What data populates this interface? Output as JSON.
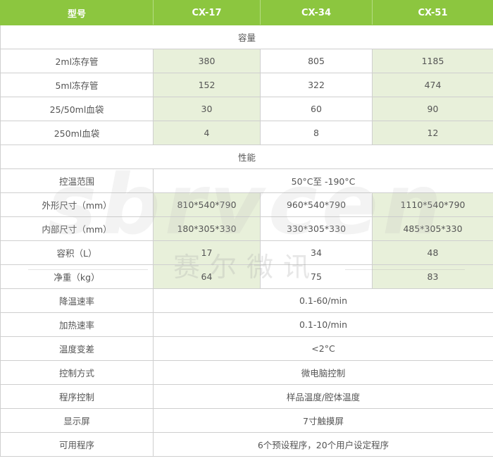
{
  "header": {
    "model_label": "型号",
    "models": [
      "CX-17",
      "CX-34",
      "CX-51"
    ]
  },
  "sections": {
    "capacity": "容量",
    "performance": "性能"
  },
  "capacity_rows": [
    {
      "label": "2ml冻存管",
      "values": [
        "380",
        "805",
        "1185"
      ]
    },
    {
      "label": "5ml冻存管",
      "values": [
        "152",
        "322",
        "474"
      ]
    },
    {
      "label": "25/50ml血袋",
      "values": [
        "30",
        "60",
        "90"
      ]
    },
    {
      "label": "250ml血袋",
      "values": [
        "4",
        "8",
        "12"
      ]
    }
  ],
  "temp_range": {
    "label": "控温范围",
    "value": "50°C至 -190°C"
  },
  "size_rows": [
    {
      "label": "外形尺寸（mm）",
      "values": [
        "810*540*790",
        "960*540*790",
        "1110*540*790"
      ]
    },
    {
      "label": "内部尺寸（mm）",
      "values": [
        "180*305*330",
        "330*305*330",
        "485*305*330"
      ]
    },
    {
      "label": "容积（L）",
      "values": [
        "17",
        "34",
        "48"
      ]
    },
    {
      "label": "净重（kg）",
      "values": [
        "64",
        "75",
        "83"
      ]
    }
  ],
  "shared_rows": [
    {
      "label": "降温速率",
      "value": "0.1-60/min"
    },
    {
      "label": "加热速率",
      "value": "0.1-10/min"
    },
    {
      "label": "温度变差",
      "value": "<2°C"
    },
    {
      "label": "控制方式",
      "value": "微电脑控制"
    },
    {
      "label": "程序控制",
      "value": "样品温度/腔体温度"
    },
    {
      "label": "显示屏",
      "value": "7寸触摸屏"
    },
    {
      "label": "可用程序",
      "value": "6个预设程序，20个用户设定程序"
    }
  ],
  "watermark": {
    "latin": "sbrvcen",
    "chinese": "赛尔微讯"
  }
}
